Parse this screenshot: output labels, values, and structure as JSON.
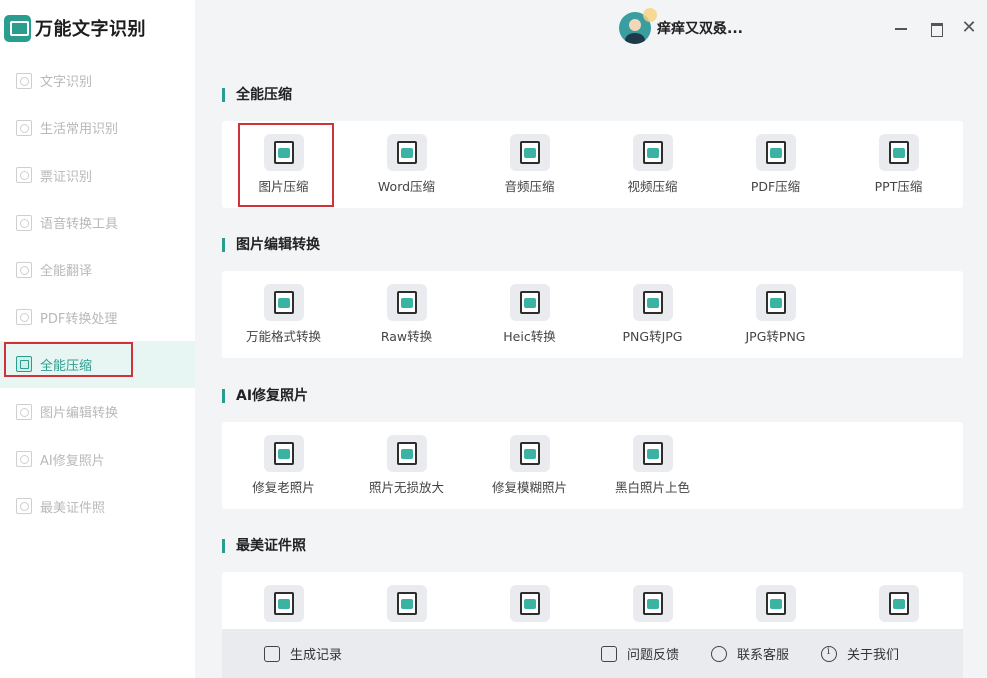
{
  "app": {
    "name": "万能文字识别"
  },
  "user": {
    "name": "痒痒又双叒..."
  },
  "window": {
    "minimize": "",
    "maximize": "",
    "close": "✕"
  },
  "sidebar": {
    "items": [
      {
        "label": "文字识别",
        "icon": "text-scan-icon"
      },
      {
        "label": "生活常用识别",
        "icon": "life-scan-icon"
      },
      {
        "label": "票证识别",
        "icon": "ticket-scan-icon"
      },
      {
        "label": "语音转换工具",
        "icon": "voice-convert-icon"
      },
      {
        "label": "全能翻译",
        "icon": "translate-icon"
      },
      {
        "label": "PDF转换处理",
        "icon": "pdf-convert-icon"
      },
      {
        "label": "全能压缩",
        "icon": "compress-icon",
        "active": true
      },
      {
        "label": "图片编辑转换",
        "icon": "image-edit-icon"
      },
      {
        "label": "AI修复照片",
        "icon": "ai-repair-icon"
      },
      {
        "label": "最美证件照",
        "icon": "id-photo-icon"
      }
    ]
  },
  "sections": [
    {
      "title": "全能压缩",
      "tools": [
        {
          "label": "图片压缩",
          "icon": "image-compress-icon"
        },
        {
          "label": "Word压缩",
          "icon": "word-compress-icon"
        },
        {
          "label": "音频压缩",
          "icon": "audio-compress-icon"
        },
        {
          "label": "视频压缩",
          "icon": "video-compress-icon"
        },
        {
          "label": "PDF压缩",
          "icon": "pdf-compress-icon"
        },
        {
          "label": "PPT压缩",
          "icon": "ppt-compress-icon"
        }
      ]
    },
    {
      "title": "图片编辑转换",
      "tools": [
        {
          "label": "万能格式转换",
          "icon": "format-convert-icon"
        },
        {
          "label": "Raw转换",
          "icon": "raw-convert-icon"
        },
        {
          "label": "Heic转换",
          "icon": "heic-convert-icon"
        },
        {
          "label": "PNG转JPG",
          "icon": "png-to-jpg-icon"
        },
        {
          "label": "JPG转PNG",
          "icon": "jpg-to-png-icon"
        }
      ]
    },
    {
      "title": "AI修复照片",
      "tools": [
        {
          "label": "修复老照片",
          "icon": "repair-old-photo-icon"
        },
        {
          "label": "照片无损放大",
          "icon": "lossless-upscale-icon"
        },
        {
          "label": "修复模糊照片",
          "icon": "repair-blur-photo-icon"
        },
        {
          "label": "黑白照片上色",
          "icon": "colorize-photo-icon"
        }
      ]
    },
    {
      "title": "最美证件照",
      "tools": [
        {
          "label": "",
          "icon": "id-photo-1-icon"
        },
        {
          "label": "",
          "icon": "id-photo-2-icon"
        },
        {
          "label": "",
          "icon": "id-photo-3-icon"
        },
        {
          "label": "",
          "icon": "id-photo-4-icon"
        },
        {
          "label": "",
          "icon": "id-photo-5-icon"
        },
        {
          "label": "",
          "icon": "id-photo-6-icon"
        }
      ]
    }
  ],
  "footer": {
    "history": "生成记录",
    "feedback": "问题反馈",
    "support": "联系客服",
    "about": "关于我们"
  },
  "colors": {
    "accent": "#2a9d8f",
    "highlight": "#d0323a"
  }
}
